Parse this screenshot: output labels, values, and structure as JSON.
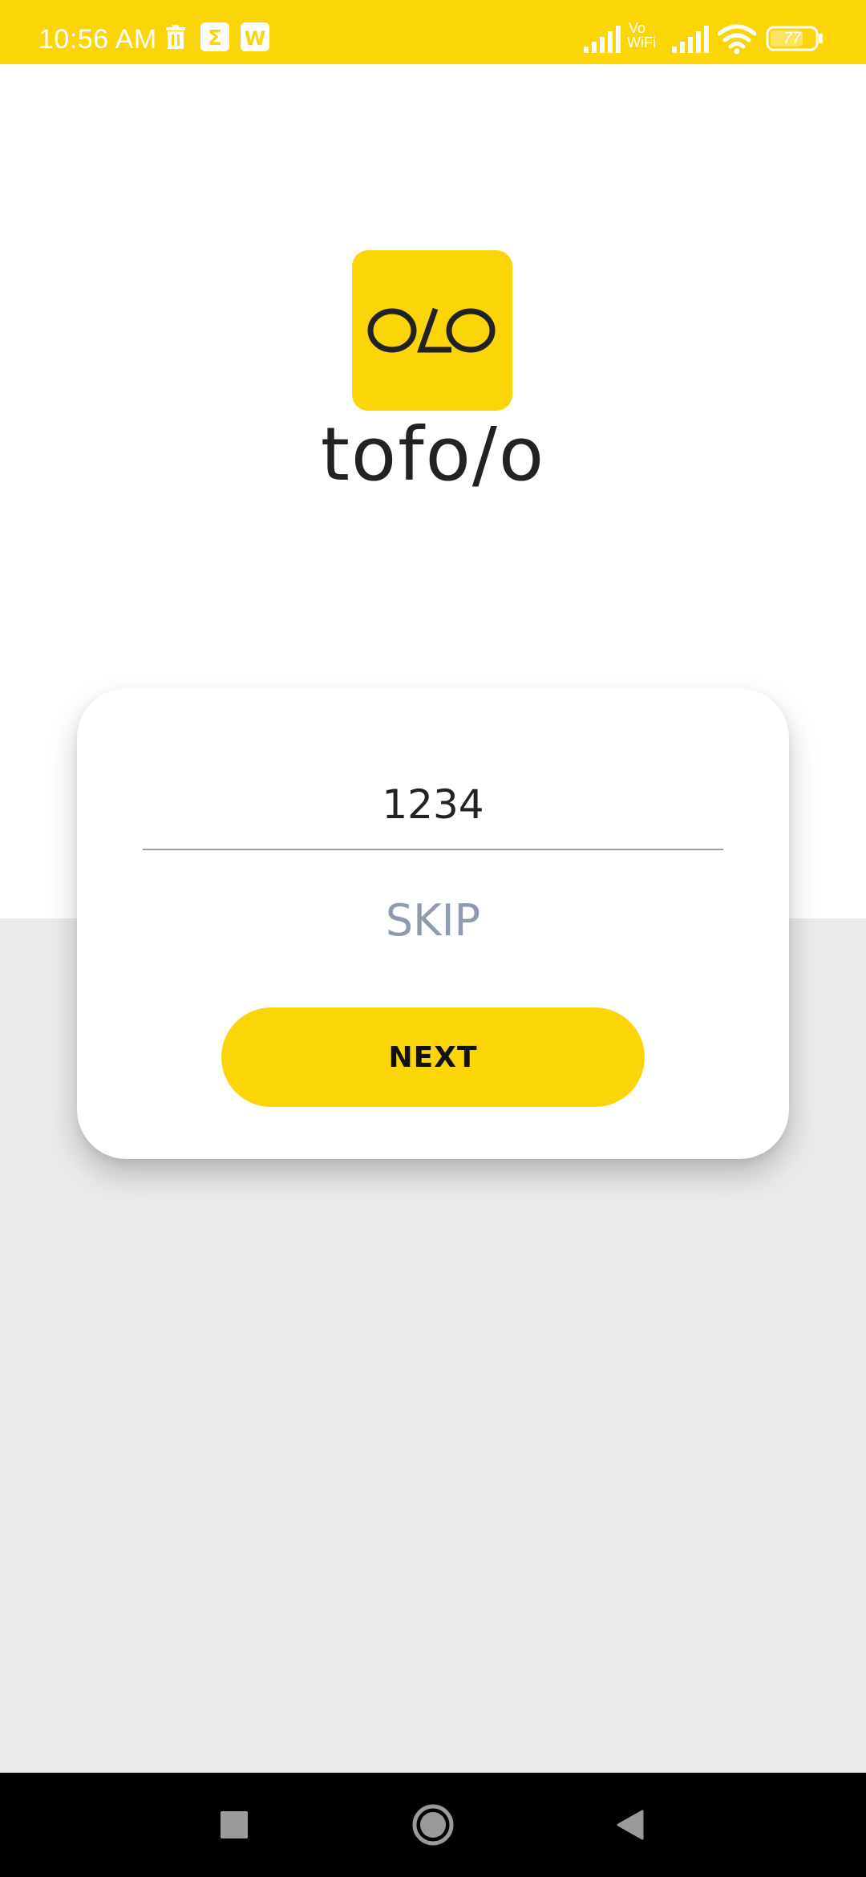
{
  "status_bar": {
    "time": "10:56 AM",
    "vo_wifi_top": "Vo",
    "vo_wifi_bottom": "WiFi",
    "battery": "77",
    "icons": [
      "trash-icon",
      "sigma-icon",
      "w-app-icon",
      "signal-icon",
      "vo-wifi-icon",
      "signal-icon",
      "wifi-icon",
      "battery-icon"
    ]
  },
  "brand": {
    "logo_text": "tofo/o",
    "tile_color": "#FCD509"
  },
  "form": {
    "code_value": "1234",
    "skip_label": "SKIP",
    "next_label": "NEXT"
  },
  "nav_bar": {
    "icons": [
      "recents-square-icon",
      "home-circle-icon",
      "back-triangle-icon"
    ]
  },
  "colors": {
    "accent": "#FCD509",
    "skip_text": "#8E9AAD",
    "lower_background": "#EAEAEA"
  }
}
